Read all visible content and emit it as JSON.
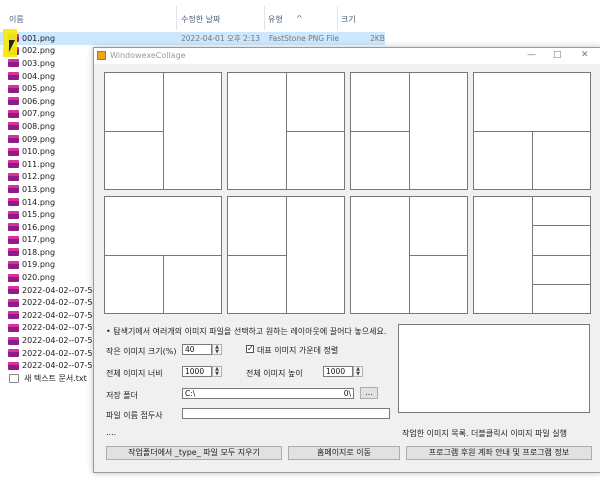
{
  "explorer": {
    "columns": {
      "name": "이름",
      "modified": "수정한 날짜",
      "type": "유형",
      "size": "크기"
    },
    "selected_row": {
      "modified": "2022-04-01 오후 2:13",
      "type": "FastStone PNG File",
      "size": "2KB"
    },
    "files": [
      "001.png",
      "002.png",
      "003.png",
      "004.png",
      "005.png",
      "006.png",
      "007.png",
      "008.png",
      "009.png",
      "010.png",
      "011.png",
      "012.png",
      "013.png",
      "014.png",
      "015.png",
      "016.png",
      "017.png",
      "018.png",
      "019.png",
      "020.png",
      "2022-04-02--07-54-4",
      "2022-04-02--07-54-4",
      "2022-04-02--07-54-4",
      "2022-04-02--07-55-0",
      "2022-04-02--07-55-1",
      "2022-04-02--07-55-1",
      "2022-04-02--07-55-1"
    ],
    "text_file": "새 텍스트 문서.txt"
  },
  "dialog": {
    "title": "WindowexeCollage",
    "minimize": "—",
    "maximize": "□",
    "close": "✕",
    "instruction": "• 탐색기에서 여러개의 이미지 파일을 선택하고 원하는 레이아웃에 끌어다 놓으세요.",
    "small_size_label": "작은 이미지 크기(%)",
    "small_size_value": "40",
    "center_checkbox_label": "대표 이미지 가운데 정렬",
    "center_checked": true,
    "total_width_label": "전체 이미지 너비",
    "total_width_value": "1000",
    "total_height_label": "전체 이미지 높이",
    "total_height_value": "1000",
    "save_folder_label": "저장 폴더",
    "save_folder_value": "C:\\",
    "save_folder_tail": "0\\",
    "browse_label": "...",
    "prefix_label": "파일 이름 접두사",
    "prefix_value": "",
    "status_text": "....",
    "list_caption": "작업한 이미지 목록. 더블클릭시 이미지 파일 실행",
    "btn_clear": "작업폴더에서 _type_ 파일 모두 지우기",
    "btn_home": "홈페이지로 이동",
    "btn_info": "프로그램 후원 계좌 안내 및 프로그램 정보"
  }
}
